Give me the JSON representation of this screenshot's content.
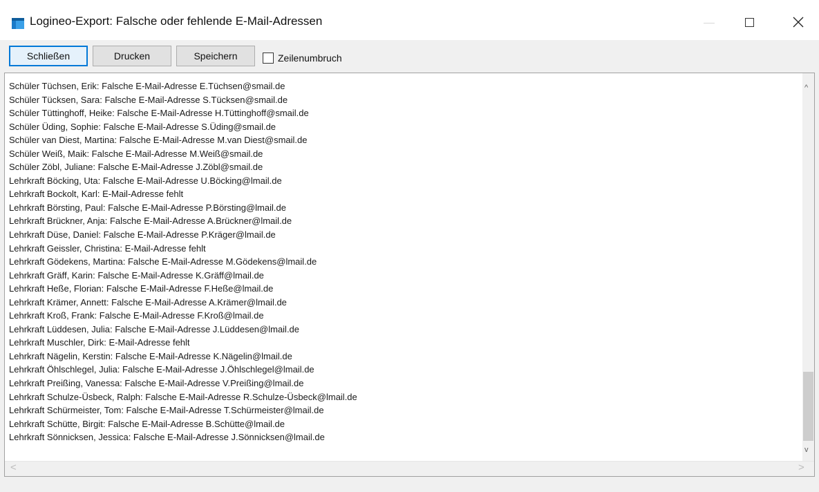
{
  "window": {
    "title": "Logineo-Export: Falsche oder fehlende E-Mail-Adressen",
    "icon": "application-icon",
    "accent_color": "#0078d7"
  },
  "toolbar": {
    "close_label": "Schließen",
    "print_label": "Drucken",
    "save_label": "Speichern",
    "wrap_label": "Zeilenumbruch",
    "wrap_checked": false
  },
  "content": {
    "lines": [
      "Schüler Tüchsen, Erik: Falsche E-Mail-Adresse E.Tüchsen@smail.de",
      "Schüler Tücksen, Sara: Falsche E-Mail-Adresse S.Tücksen@smail.de",
      "Schüler Tüttinghoff, Heike: Falsche E-Mail-Adresse H.Tüttinghoff@smail.de",
      "Schüler Üding, Sophie: Falsche E-Mail-Adresse S.Üding@smail.de",
      "Schüler van Diest, Martina: Falsche E-Mail-Adresse M.van Diest@smail.de",
      "Schüler Weiß, Maik: Falsche E-Mail-Adresse M.Weiß@smail.de",
      "Schüler Zöbl, Juliane: Falsche E-Mail-Adresse J.Zöbl@smail.de",
      "Lehrkraft Böcking, Uta: Falsche E-Mail-Adresse U.Böcking@lmail.de",
      "Lehrkraft Bockolt, Karl: E-Mail-Adresse fehlt",
      "Lehrkraft Börsting, Paul: Falsche E-Mail-Adresse P.Börsting@lmail.de",
      "Lehrkraft Brückner, Anja: Falsche E-Mail-Adresse A.Brückner@lmail.de",
      "Lehrkraft Düse, Daniel: Falsche E-Mail-Adresse P.Kräger@lmail.de",
      "Lehrkraft Geissler, Christina: E-Mail-Adresse fehlt",
      "Lehrkraft Gödekens, Martina: Falsche E-Mail-Adresse M.Gödekens@lmail.de",
      "Lehrkraft Gräff, Karin: Falsche E-Mail-Adresse K.Gräff@lmail.de",
      "Lehrkraft Heße, Florian: Falsche E-Mail-Adresse F.Heße@lmail.de",
      "Lehrkraft Krämer, Annett: Falsche E-Mail-Adresse A.Krämer@lmail.de",
      "Lehrkraft Kroß, Frank: Falsche E-Mail-Adresse F.Kroß@lmail.de",
      "Lehrkraft Lüddesen, Julia: Falsche E-Mail-Adresse J.Lüddesen@lmail.de",
      "Lehrkraft Muschler, Dirk: E-Mail-Adresse fehlt",
      "Lehrkraft Nägelin, Kerstin: Falsche E-Mail-Adresse K.Nägelin@lmail.de",
      "Lehrkraft Öhlschlegel, Julia: Falsche E-Mail-Adresse J.Öhlschlegel@lmail.de",
      "Lehrkraft Preißing, Vanessa: Falsche E-Mail-Adresse V.Preißing@lmail.de",
      "Lehrkraft Schulze-Üsbeck, Ralph: Falsche E-Mail-Adresse R.Schulze-Üsbeck@lmail.de",
      "Lehrkraft Schürmeister, Tom: Falsche E-Mail-Adresse T.Schürmeister@lmail.de",
      "Lehrkraft Schütte, Birgit: Falsche E-Mail-Adresse B.Schütte@lmail.de",
      "Lehrkraft Sönnicksen, Jessica: Falsche E-Mail-Adresse J.Sönnicksen@lmail.de"
    ],
    "vertical_scroll_position": 1.0
  }
}
